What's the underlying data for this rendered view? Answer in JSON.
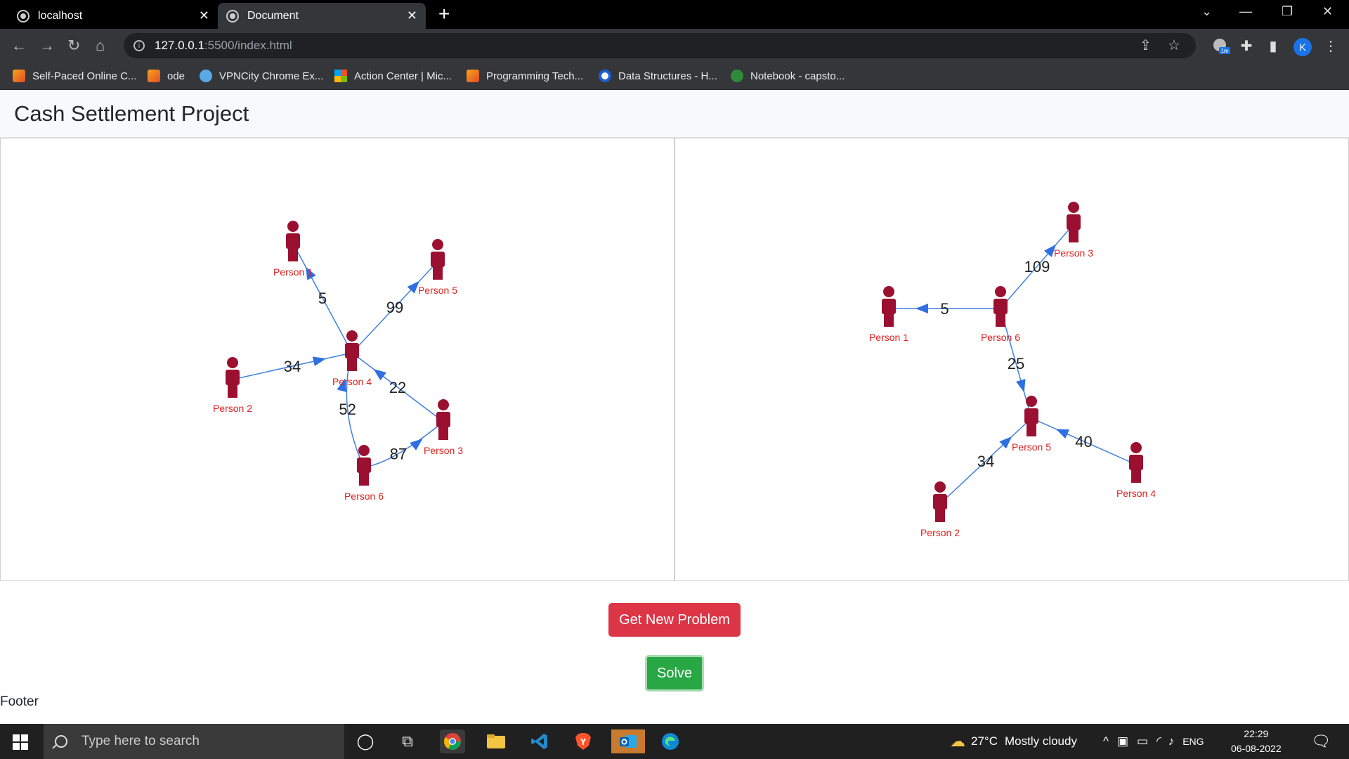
{
  "browser": {
    "tabs": [
      {
        "title": "localhost"
      },
      {
        "title": "Document"
      }
    ],
    "new_tab_symbol": "+",
    "url_host": "127.0.0.1",
    "url_path": ":5500/index.html",
    "avatar_letter": "K",
    "extension_badge": "1m",
    "bookmarks": [
      {
        "label": "Self-Paced Online C...",
        "icon": "gfg-icon"
      },
      {
        "label": "ode",
        "icon": "gfg-icon"
      },
      {
        "label": "VPNCity Chrome Ex...",
        "icon": "vpn-icon"
      },
      {
        "label": "Action Center | Mic...",
        "icon": "microsoft-icon"
      },
      {
        "label": "Programming Tech...",
        "icon": "gfg-icon"
      },
      {
        "label": "Data Structures - H...",
        "icon": "codechef-icon"
      },
      {
        "label": "Notebook - capsto...",
        "icon": "jupyter-icon"
      }
    ]
  },
  "page": {
    "title": "Cash Settlement Project",
    "button_new": "Get New Problem",
    "button_solve": "Solve",
    "footer": "Footer"
  },
  "graphs": {
    "colors": {
      "person": "#9b1030",
      "label": "#e02020",
      "edge": "#3f7fe0",
      "arrow": "#2f6fe0",
      "weight": "#222222"
    },
    "left": {
      "nodes": [
        {
          "id": "p1",
          "label": "Person 1"
        },
        {
          "id": "p2",
          "label": "Person 2"
        },
        {
          "id": "p3",
          "label": "Person 3"
        },
        {
          "id": "p4",
          "label": "Person 4"
        },
        {
          "id": "p5",
          "label": "Person 5"
        },
        {
          "id": "p6",
          "label": "Person 6"
        }
      ],
      "edges": [
        {
          "from": "p4",
          "to": "p1",
          "weight": "5"
        },
        {
          "from": "p4",
          "to": "p5",
          "weight": "99"
        },
        {
          "from": "p2",
          "to": "p4",
          "weight": "34"
        },
        {
          "from": "p3",
          "to": "p4",
          "weight": "22"
        },
        {
          "from": "p6",
          "to": "p4",
          "weight": "52"
        },
        {
          "from": "p6",
          "to": "p3",
          "weight": "87"
        }
      ]
    },
    "right": {
      "nodes": [
        {
          "id": "q1",
          "label": "Person 1"
        },
        {
          "id": "q2",
          "label": "Person 2"
        },
        {
          "id": "q3",
          "label": "Person 3"
        },
        {
          "id": "q4",
          "label": "Person 4"
        },
        {
          "id": "q5",
          "label": "Person 5"
        },
        {
          "id": "q6",
          "label": "Person 6"
        }
      ],
      "edges": [
        {
          "from": "q6",
          "to": "q3",
          "weight": "109"
        },
        {
          "from": "q6",
          "to": "q1",
          "weight": "5"
        },
        {
          "from": "q6",
          "to": "q5",
          "weight": "25"
        },
        {
          "from": "q2",
          "to": "q5",
          "weight": "34"
        },
        {
          "from": "q4",
          "to": "q5",
          "weight": "40"
        }
      ]
    }
  },
  "taskbar": {
    "search_placeholder": "Type here to search",
    "weather_temp": "27°C",
    "weather_text": "Mostly cloudy",
    "language": "ENG",
    "time": "22:29",
    "date": "06-08-2022"
  }
}
